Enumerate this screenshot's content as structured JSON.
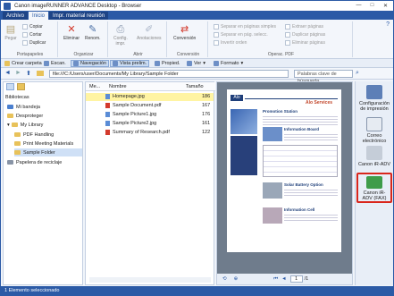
{
  "window": {
    "title": "Canon imageRUNNER ADVANCE Desktop - Browser",
    "buttons": [
      "—",
      "□",
      "✕"
    ]
  },
  "tabs": [
    "Archivo",
    "Inicio",
    "Impr. material reunión"
  ],
  "ribbon": {
    "portapapeles": {
      "label": "Portapapeles",
      "paste": "Pegar",
      "copy": "Copiar",
      "cut": "Cortar",
      "duplicate": "Duplicar"
    },
    "organizar": {
      "label": "Organizar",
      "delete": "Eliminar",
      "rename": "Renom."
    },
    "abrir": {
      "label": "Abrir",
      "config": "Config.\nimpr.",
      "annotations": "Anotaciones"
    },
    "conversion": {
      "label": "Conversión",
      "conversion": "Conversión"
    },
    "operpdf": {
      "label": "Operac. PDF",
      "sep1": "Separar en páginas simples",
      "sep2": "Separar en pág. selecc.",
      "invert": "Invertir orden",
      "extract": "Extraer páginas",
      "dup": "Duplicar páginas",
      "del": "Eliminar páginas"
    }
  },
  "toolbar": {
    "create_folder": "Crear carpeta",
    "scan": "Escan.",
    "navigation": "Navegación",
    "vista": "Vista prelim.",
    "props": "Propied.",
    "view": "Ver",
    "format": "Formato"
  },
  "address": {
    "path": "file:///C:/Users/user/Documents/My Library/Sample Folder",
    "search_placeholder": "Palabras clave de búsqueda"
  },
  "tree": {
    "header": "Bibliotecas",
    "items": [
      {
        "label": "Mi bandeja"
      },
      {
        "label": "Desproteger"
      },
      {
        "label": "My Library"
      },
      {
        "label": "PDF Handling"
      },
      {
        "label": "Print Meeting Materials"
      },
      {
        "label": "Sample Folder"
      },
      {
        "label": "Papelera de reciclaje"
      }
    ]
  },
  "list": {
    "headers": {
      "me": "Me...",
      "name": "Nombre",
      "size": "Tamaño"
    },
    "rows": [
      {
        "name": "Homepage.jpg",
        "size": "186"
      },
      {
        "name": "Sample Document.pdf",
        "size": "167"
      },
      {
        "name": "Sample Picture1.jpg",
        "size": "176"
      },
      {
        "name": "Sample Picture2.jpg",
        "size": "161"
      },
      {
        "name": "Summary of Research.pdf",
        "size": "122"
      }
    ]
  },
  "preview": {
    "page_num": "1",
    "page_total": "/1",
    "brand": "Alo",
    "services": "Alo Services",
    "promo": "Promotion Station",
    "info": "Information Board",
    "solar": "Solar Battery Option",
    "cell": "Information Cell"
  },
  "right": {
    "items": [
      "Configuración de impresión",
      "Correo electrónico",
      "Canon iR-ADV",
      "Canon iR-ADV (FAX)"
    ]
  },
  "status": {
    "text": "1 Elemento seleccionado"
  },
  "colors": {
    "accent": "#2b5aa6",
    "highlight": "#d9261c",
    "selected_row": "#fff4a3"
  }
}
